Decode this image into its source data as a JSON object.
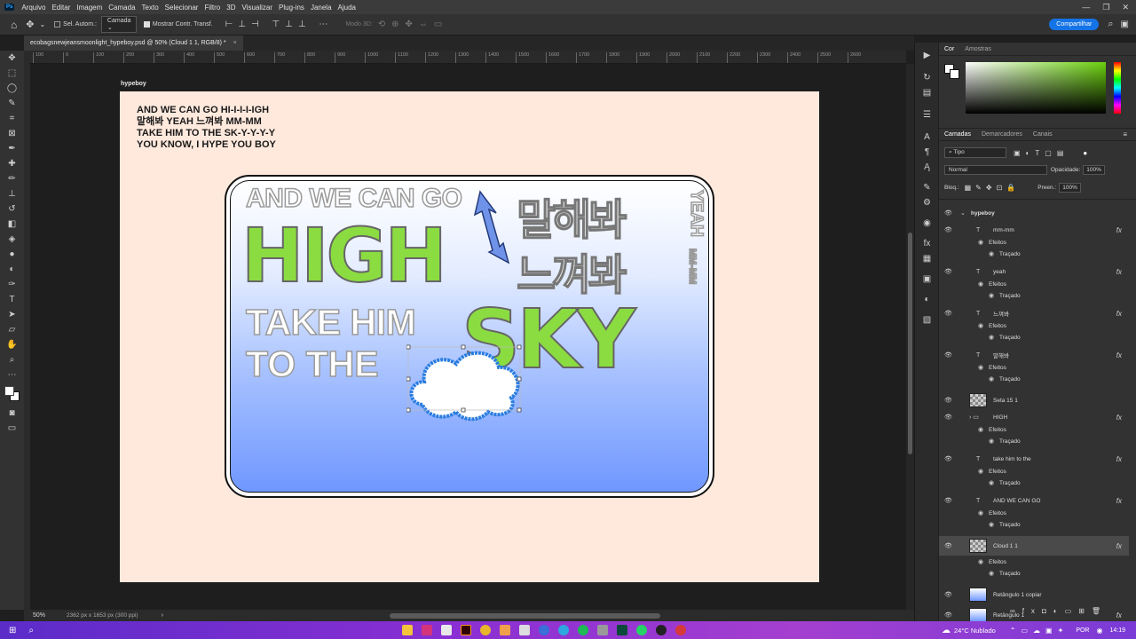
{
  "menubar": {
    "logo": "Ps",
    "items": [
      "Arquivo",
      "Editar",
      "Imagem",
      "Camada",
      "Texto",
      "Selecionar",
      "Filtro",
      "3D",
      "Visualizar",
      "Plug-ins",
      "Janela",
      "Ajuda"
    ]
  },
  "options": {
    "auto_select_label": "Sel. Autom.:",
    "auto_select_value": "Camada",
    "show_transform_label": "Mostrar Contr. Transf.",
    "mode3d": "Modo 3D:",
    "share_button": "Compartilhar"
  },
  "document": {
    "tab_title": "ecobagsnewjeansmoonlight_hypeboy.psd @ 50% (Cloud 1 1, RGB/8) *",
    "artboard_name": "hypeboy",
    "ruler_ticks": [
      "100",
      "0",
      "100",
      "200",
      "300",
      "400",
      "500",
      "600",
      "700",
      "800",
      "900",
      "1000",
      "1100",
      "1200",
      "1300",
      "1400",
      "1500",
      "1600",
      "1700",
      "1800",
      "1900",
      "2000",
      "2100",
      "2200",
      "2300",
      "2400",
      "2500",
      "2600"
    ],
    "zoom": "50%",
    "doc_info": "2362 px x 1653 px (300 ppi)"
  },
  "artwork": {
    "lyrics": [
      "AND WE CAN GO HI-I-I-I-IGH",
      "말해봐 YEAH 느껴봐 MM-MM",
      "TAKE HIM TO THE SK-Y-Y-Y-Y",
      "YOU KNOW, I HYPE YOU BOY"
    ],
    "line1": "AND WE CAN GO",
    "high": "HIGH",
    "take_him": "TAKE HIM",
    "to_the": "TO THE",
    "sky": "SKY",
    "kor1": "말해봐",
    "kor2": "느껴봐",
    "yeah": "YEAH",
    "mmmm": "MM-MM"
  },
  "panels": {
    "color_tabs": [
      "Cor",
      "Amostras"
    ],
    "layer_tabs": [
      "Camadas",
      "Demarcadores",
      "Canais"
    ],
    "kind_filter": "Tipo",
    "blend_mode": "Normal",
    "opacity_label": "Opacidade:",
    "opacity_value": "100%",
    "lock_label": "Bloq.:",
    "fill_label": "Preen.:",
    "fill_value": "100%",
    "layers": [
      {
        "name": "hypeboy",
        "type": "artboard"
      },
      {
        "name": "mm-mm",
        "type": "text"
      },
      {
        "name": "Efeitos",
        "type": "effect"
      },
      {
        "name": "Traçado",
        "type": "sub"
      },
      {
        "name": "yeah",
        "type": "text"
      },
      {
        "name": "Efeitos",
        "type": "effect"
      },
      {
        "name": "Traçado",
        "type": "sub"
      },
      {
        "name": "느껴봐",
        "type": "text"
      },
      {
        "name": "Efeitos",
        "type": "effect"
      },
      {
        "name": "Traçado",
        "type": "sub"
      },
      {
        "name": "말해봐",
        "type": "text"
      },
      {
        "name": "Efeitos",
        "type": "effect"
      },
      {
        "name": "Traçado",
        "type": "sub"
      },
      {
        "name": "Seta 15 1",
        "type": "image"
      },
      {
        "name": "HIGH",
        "type": "group"
      },
      {
        "name": "Efeitos",
        "type": "effect"
      },
      {
        "name": "Traçado",
        "type": "sub"
      },
      {
        "name": "take him to the",
        "type": "text"
      },
      {
        "name": "Efeitos",
        "type": "effect"
      },
      {
        "name": "Traçado",
        "type": "sub"
      },
      {
        "name": "AND WE CAN GO",
        "type": "text"
      },
      {
        "name": "Efeitos",
        "type": "effect"
      },
      {
        "name": "Traçado",
        "type": "sub"
      },
      {
        "name": "Cloud 1 1",
        "type": "image"
      },
      {
        "name": "Efeitos",
        "type": "effect"
      },
      {
        "name": "Traçado",
        "type": "sub"
      },
      {
        "name": "Retângulo 1 copiar",
        "type": "image"
      },
      {
        "name": "Retângulo 1",
        "type": "image"
      },
      {
        "name": "Efeitos",
        "type": "effect"
      }
    ]
  },
  "taskbar": {
    "weather": "24°C  Nublado",
    "lang": "POR",
    "time": "14:19"
  },
  "colors": {
    "accent": "#1473e6",
    "green": "#8bdc41",
    "artboard_bg": "#ffe9dd"
  }
}
